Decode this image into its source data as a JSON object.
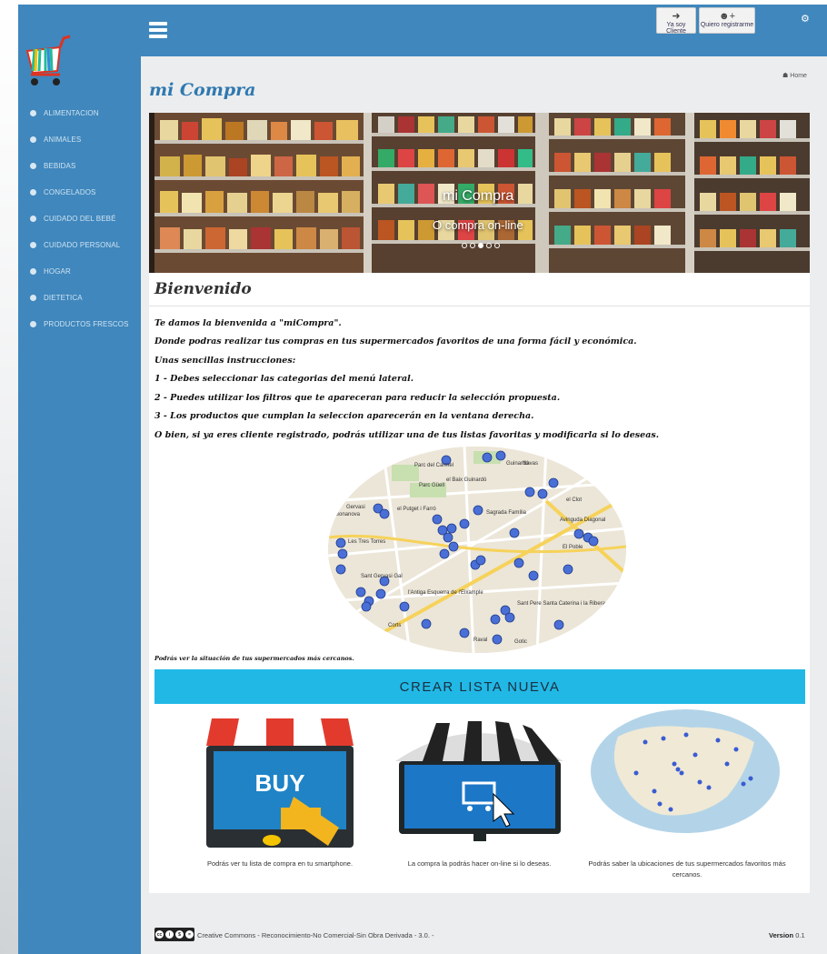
{
  "header": {
    "btn_cliente": "Ya soy Cliente",
    "btn_registro": "Quiero registrarme"
  },
  "sidebar": {
    "items": [
      {
        "label": "ALIMENTACION"
      },
      {
        "label": "ANIMALES"
      },
      {
        "label": "BEBIDAS"
      },
      {
        "label": "CONGELADOS"
      },
      {
        "label": "CUIDADO DEL BEBÉ"
      },
      {
        "label": "CUIDADO PERSONAL"
      },
      {
        "label": "HOGAR"
      },
      {
        "label": "DIETETICA"
      },
      {
        "label": "PRODUCTOS FRESCOS"
      }
    ]
  },
  "page": {
    "title": "mi Compra",
    "breadcrumb": "Home"
  },
  "carousel": {
    "title": "mi Compra",
    "subtitle": "O compra on-line"
  },
  "welcome": {
    "heading": "Bienvenido",
    "lines": [
      "Te damos la bienvenida a \"miCompra\".",
      "Donde podras realizar tus compras en tus supermercados favoritos de una forma fácil y económica.",
      "Unas sencillas instrucciones:",
      "1 - Debes seleccionar las categorias del menú lateral.",
      "2 - Puedes utilizar los filtros que te apareceran para reducir la selección propuesta.",
      "3 - Los productos que cumplan la seleccion aparecerán en la ventana derecha.",
      "O bien, si ya eres cliente registrado, podrás utilizar una de tus listas favoritas y modificarla si lo deseas."
    ],
    "map_caption": "Podrás ver la situación de tus supermercados más cercanos.",
    "map_labels": [
      "Parc del Carmel",
      "Guinardó",
      "Navas",
      "Parc Güell",
      "el Baix Guinardó",
      "Gervasi",
      "Bonanova",
      "el Putget i Farró",
      "Sagrada Família",
      "el Clot",
      "Les Tres Torres",
      "El Poble",
      "Sant Gervasi Gal",
      "l'Antiga Esquerra de l'Eixample",
      "Sant Pere Santa Caterina i la Ribera",
      "Raval",
      "Gotic",
      "Corts",
      "Avinguda Diagonal"
    ]
  },
  "crear_btn": "CREAR LISTA NUEVA",
  "features": [
    {
      "buy_text": "BUY",
      "caption": "Podrás ver tu lista de compra en tu smartphone."
    },
    {
      "caption": "La compra la podrás hacer on-line si lo deseas."
    },
    {
      "caption": "Podrás saber la ubicaciones de tus supermercados favoritos más cercanos."
    }
  ],
  "footer": {
    "license": "Creative Commons - Reconocimiento-No Comercial-Sin Obra Derivada - 3.0. -",
    "version_label": "Version",
    "version_number": "0.1"
  },
  "colors": {
    "primary": "#3f87bd",
    "cta": "#22b8e6"
  }
}
